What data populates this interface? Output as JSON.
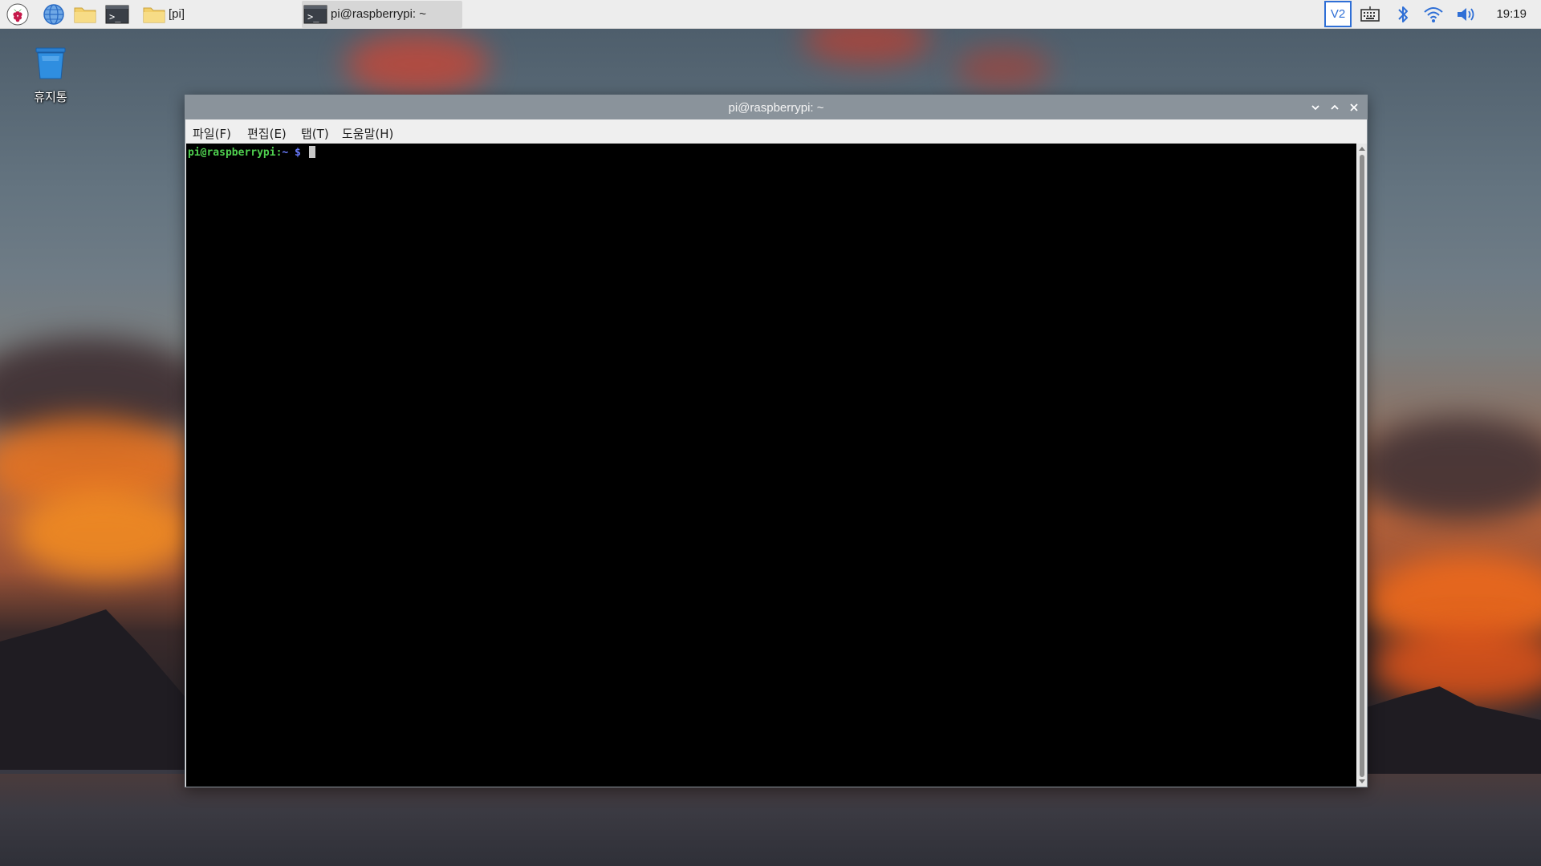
{
  "taskbar": {
    "folder_label": "[pi]",
    "task_label": "pi@raspberrypi: ~",
    "clock": "19:19",
    "vnc_label": "V2"
  },
  "desktop": {
    "trash_label": "휴지통"
  },
  "terminal": {
    "title": "pi@raspberrypi: ~",
    "menu": {
      "file": "파일(F)",
      "edit": "편집(E)",
      "tab": "탭(T)",
      "help": "도움말(H)"
    },
    "prompt": {
      "user_host": "pi@raspberrypi",
      "separator": ":",
      "path": "~",
      "symbol": " $"
    }
  },
  "colors": {
    "taskbar_bg": "#ededed",
    "titlebar_bg": "#8a939b",
    "terminal_bg": "#000000",
    "prompt_green": "#4fd04f",
    "prompt_blue": "#6a7cff",
    "vnc_blue": "#2f6fd6"
  }
}
